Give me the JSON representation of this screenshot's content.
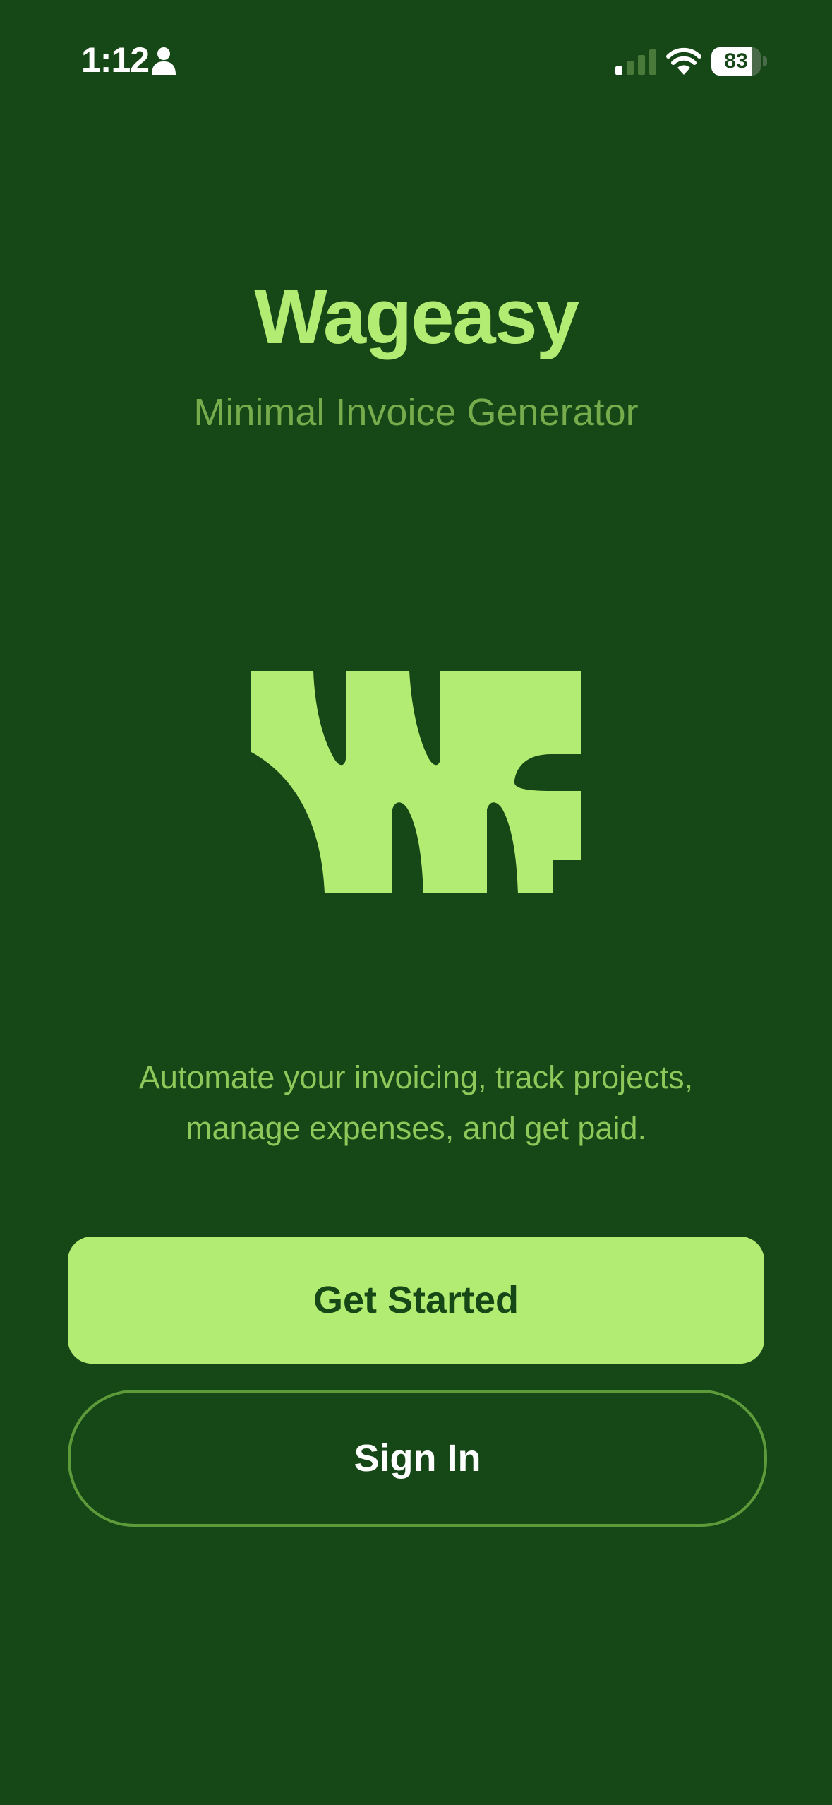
{
  "status_bar": {
    "time": "1:12",
    "battery_level": "83",
    "battery_fraction": 0.83,
    "icons": [
      "person-icon",
      "cellular-signal-icon",
      "wifi-icon",
      "battery-icon"
    ]
  },
  "app": {
    "title": "Wageasy",
    "subtitle": "Minimal Invoice Generator",
    "logo_icon": "wageasy-logo"
  },
  "tagline": {
    "line1": "Automate your invoicing, track projects,",
    "line2": "manage expenses, and get paid."
  },
  "actions": {
    "primary_label": "Get Started",
    "secondary_label": "Sign In"
  },
  "colors": {
    "background": "#164716",
    "accent": "#b2ec72",
    "subtitle": "#76ac4c",
    "tagline": "#8ec85a",
    "outline": "#5c9a3a"
  }
}
